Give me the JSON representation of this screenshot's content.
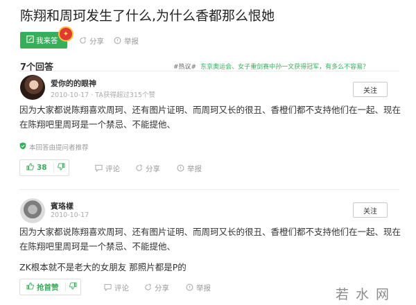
{
  "question": {
    "title": "陈翔和周珂发生了什么,为什么香都那么恨她",
    "answer_button": "我来答",
    "share": "分享",
    "report": "举报"
  },
  "answers_header": {
    "count": "7个回答",
    "hot_label": "#热议#",
    "hot_topic": "东京奥运会、女子重剑赛中孙一文获得冠军，有多么不容易？"
  },
  "answers": [
    {
      "user": "爱你的的眼神",
      "date": "2010-10-17",
      "meta": "TA获得超过315个赞",
      "follow": "关注",
      "lines": [
        "因为大家都说陈翔喜欢周珂、还有图片证明、而周珂又长的很丑、香橙们都不支持他们在一起、现在",
        "在陈翔吧里周珂是一个禁忌、不能提他、"
      ],
      "recommend": "本回答由提问者推荐",
      "likes": "38",
      "comment": "评论",
      "share": "分享",
      "report": "举报"
    },
    {
      "user": "賓珞樣",
      "date": "2010-10-17",
      "follow": "关注",
      "lines": [
        "因为大家都说陈翔喜欢周珂、还有图片证明、而周珂又长的很丑、香橙们都不支持他们在一起、现在",
        "在陈翔吧里周珂是一个禁忌、不能提他、"
      ],
      "extra": "ZK根本就不是老大的女朋友 那照片都是P的",
      "likes": "抢首赞",
      "comment": "评论",
      "share": "分享",
      "report": "举报"
    }
  ],
  "watermark": "若水网",
  "colors": {
    "accent": "#38ad5a",
    "text": "#333333",
    "muted": "#999999"
  },
  "icons": [
    "edit-icon",
    "share-icon",
    "report-icon",
    "thumb-up-icon",
    "thumb-down-icon",
    "comment-icon",
    "shield-check-icon"
  ]
}
